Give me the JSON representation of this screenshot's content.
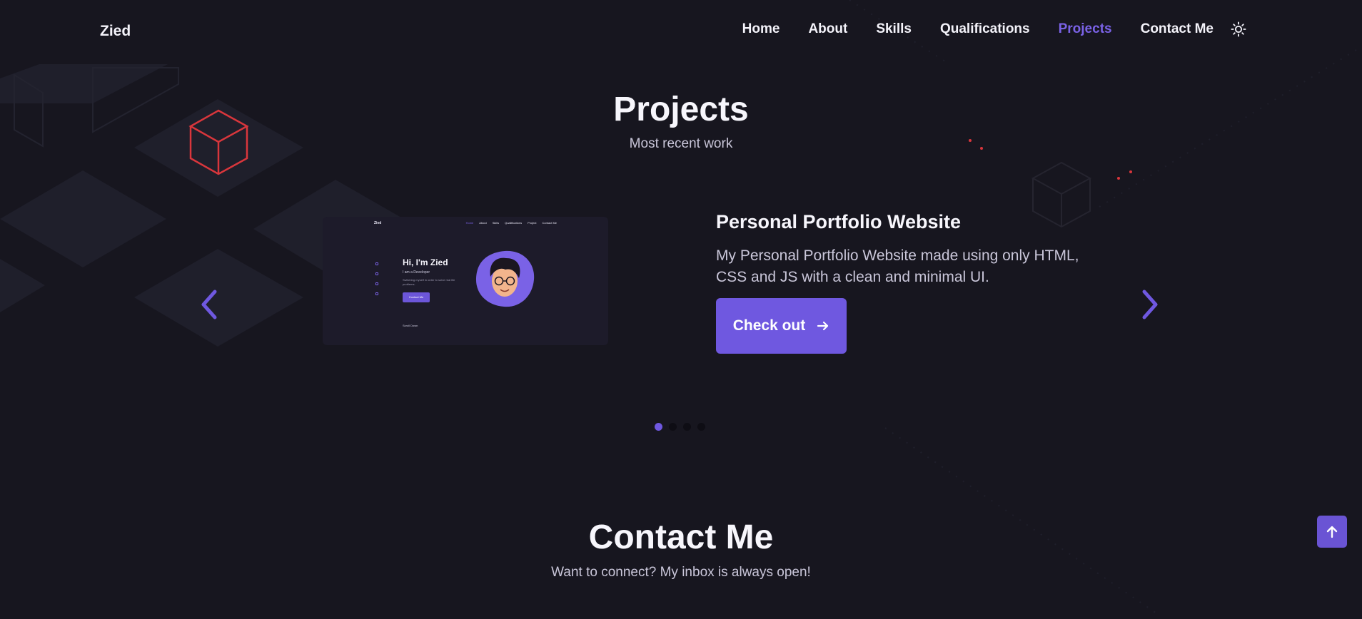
{
  "header": {
    "logo": "Zied",
    "nav": [
      "Home",
      "About",
      "Skills",
      "Qualifications",
      "Projects",
      "Contact Me"
    ],
    "active_nav": "Projects",
    "theme_icon": "sun-icon"
  },
  "projects": {
    "title": "Projects",
    "subtitle": "Most recent work",
    "current": {
      "title": "Personal Portfolio Website",
      "description": "My Personal Portfolio Website made using only HTML, CSS and JS with a clean and minimal UI.",
      "button_label": "Check out",
      "preview": {
        "logo": "Zied",
        "nav": [
          "Home",
          "About",
          "Skills",
          "Qualifications",
          "Project",
          "Contact Me"
        ],
        "greeting": "Hi, I'm Zied",
        "role": "I am a Developer",
        "description": "Switching myself in order to solve real life problems.",
        "button": "Contact Me",
        "scroll_label": "Scroll Down"
      }
    },
    "slides_count": 4,
    "active_slide": 1
  },
  "contact": {
    "title": "Contact Me",
    "subtitle": "Want to connect? My inbox is always open!"
  },
  "colors": {
    "background": "#17161f",
    "accent": "#6f58e0",
    "text": "#f4f3fa",
    "muted_text": "#c9c6d9",
    "decor_red": "#e0383e"
  }
}
